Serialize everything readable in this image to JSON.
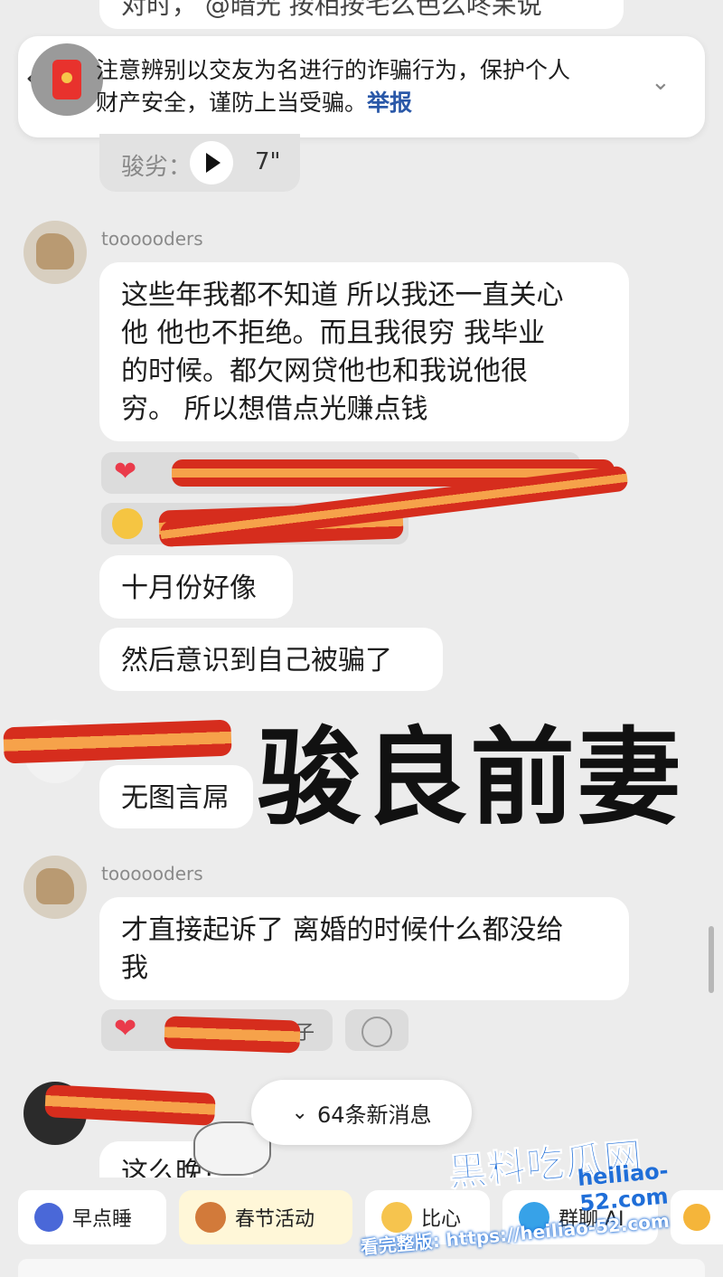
{
  "top_partial_text": "对时， @暗光 按相按宅么色么咚呆说",
  "notice": {
    "text_line1": "注意辨别以交友为名进行的诈骗行为，保护个人",
    "text_line2": "财产安全，谨防上当受骗。",
    "report_link": "举报"
  },
  "voice_message": {
    "label": "骏劣：",
    "duration": "7\""
  },
  "messages": [
    {
      "username": "toooooders",
      "lines": [
        "这些年我都不知道 所以我还一直关心",
        "他 他也不拒绝。而且我很穷  我毕业",
        "的时候。都欠网贷他也和我说他很",
        "穷。 所以想借点光赚点钱"
      ]
    },
    {
      "text": "十月份好像"
    },
    {
      "text": "然后意识到自己被骗了"
    },
    {
      "text": "无图言屌"
    },
    {
      "username": "toooooders",
      "lines": [
        "才直接起诉了 离婚的时候什么都没给",
        "我"
      ],
      "reaction_partial": "子"
    },
    {
      "text": "这么晚?"
    }
  ],
  "overlay_title": "骏良前妻",
  "new_messages_pill": "64条新消息",
  "quick_bar": [
    {
      "label": "早点睡",
      "icon": "moon-icon"
    },
    {
      "label": "春节活动",
      "icon": "festival-icon"
    },
    {
      "label": "比心",
      "icon": "heart-hand-icon"
    },
    {
      "label": "群聊 AI",
      "icon": "ai-icon"
    }
  ],
  "watermark": {
    "brand": "黑料吃瓜网",
    "url": "heiliao-52.com",
    "line": "看完整版: https://heiliao-52.com"
  },
  "colors": {
    "background": "#ececec",
    "link_blue": "#2a58a8",
    "redact_red": "#d62d1d",
    "redact_orange": "#f6a24a"
  }
}
